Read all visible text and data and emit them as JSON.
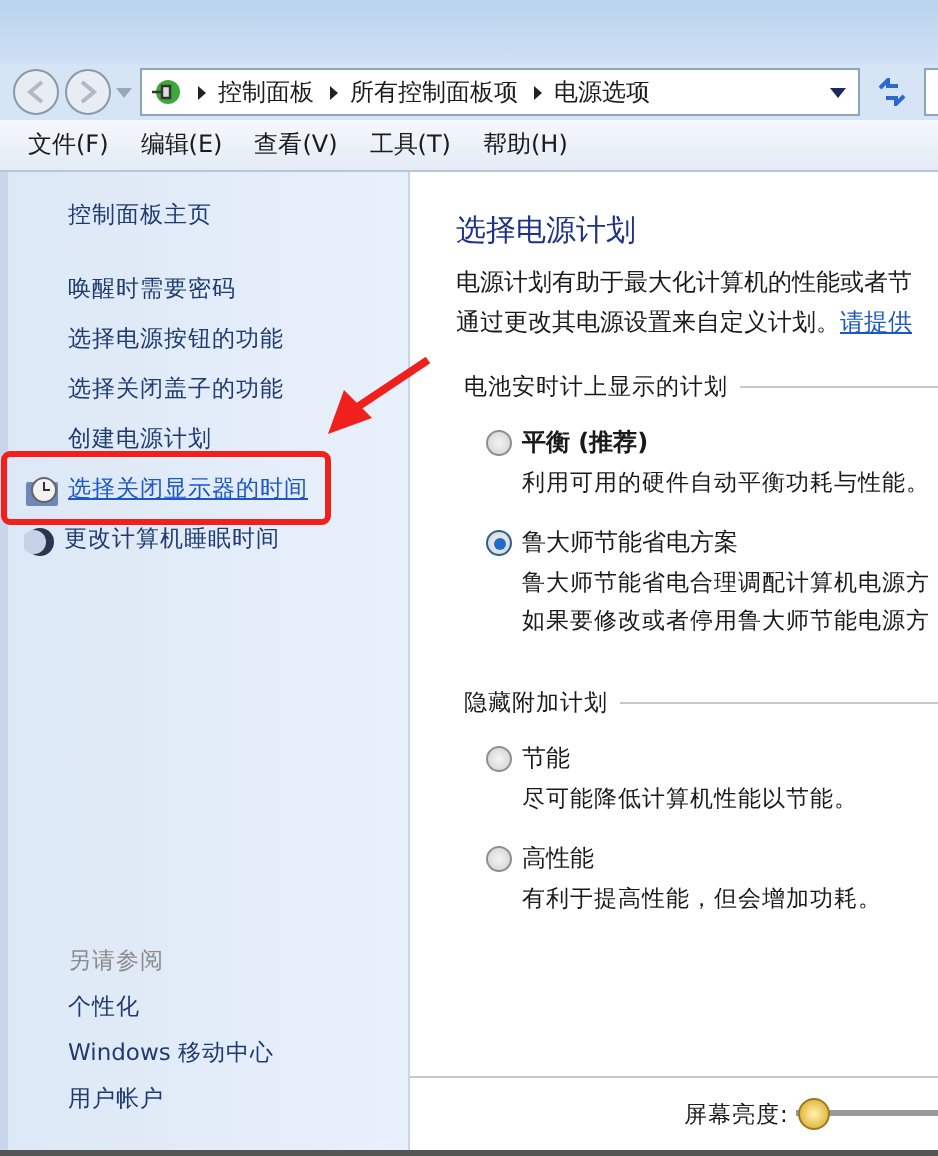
{
  "breadcrumb": [
    "控制面板",
    "所有控制面板项",
    "电源选项"
  ],
  "menu": [
    "文件(F)",
    "编辑(E)",
    "查看(V)",
    "工具(T)",
    "帮助(H)"
  ],
  "sidebar": {
    "home": "控制面板主页",
    "items": [
      {
        "label": "唤醒时需要密码",
        "kind": "link",
        "hovered": false
      },
      {
        "label": "选择电源按钮的功能",
        "kind": "link",
        "hovered": false
      },
      {
        "label": "选择关闭盖子的功能",
        "kind": "link",
        "hovered": false
      },
      {
        "label": "创建电源计划",
        "kind": "link",
        "hovered": false
      },
      {
        "label": "选择关闭显示器的时间",
        "kind": "clock",
        "hovered": true
      },
      {
        "label": "更改计算机睡眠时间",
        "kind": "moon",
        "hovered": false
      }
    ],
    "see_also": {
      "title": "另请参阅",
      "items": [
        "个性化",
        "Windows 移动中心",
        "用户帐户"
      ]
    }
  },
  "content": {
    "title": "选择电源计划",
    "description": [
      "电源计划有助于最大化计算机的性能或者节"
    ],
    "description_2": "通过更改其电源设置来自定义计划。",
    "link": "请提供",
    "groups": [
      {
        "title": "电池安时计上显示的计划",
        "plans": [
          {
            "name": "平衡 (推荐)",
            "recommended": true,
            "selected": false,
            "lines": [
              "利用可用的硬件自动平衡功耗与性能。"
            ]
          },
          {
            "name": "鲁大师节能省电方案",
            "recommended": false,
            "selected": true,
            "lines": [
              "鲁大师节能省电合理调配计算机电源方",
              "如果要修改或者停用鲁大师节能电源方"
            ]
          }
        ]
      },
      {
        "title": "隐藏附加计划",
        "plans": [
          {
            "name": "节能",
            "recommended": false,
            "selected": false,
            "lines": [
              "尽可能降低计算机性能以节能。"
            ]
          },
          {
            "name": "高性能",
            "recommended": false,
            "selected": false,
            "lines": [
              "有利于提高性能，但会增加功耗。"
            ]
          }
        ]
      }
    ],
    "brightness": {
      "label": "屏幕亮度:",
      "level": 0.02
    }
  }
}
